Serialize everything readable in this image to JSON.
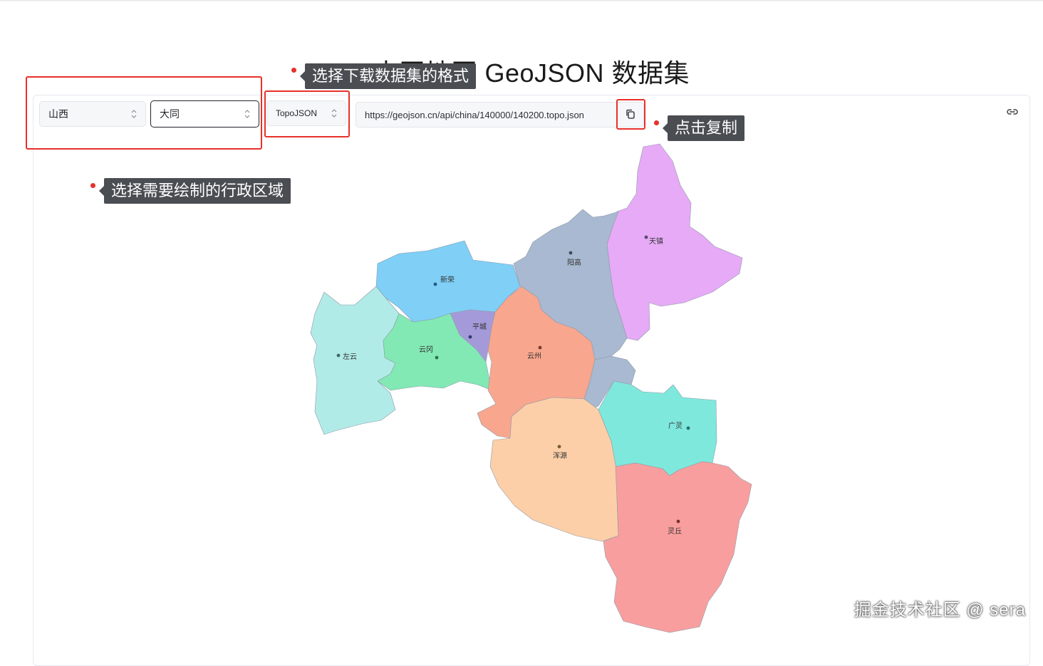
{
  "page": {
    "title": "中国地图 GeoJSON 数据集"
  },
  "controls": {
    "province": "山西",
    "city": "大同",
    "format": "TopoJSON",
    "url": "https://geojson.cn/api/china/140000/140200.topo.json"
  },
  "annotations": {
    "format_tip": "选择下载数据集的格式",
    "copy_tip": "点击复制",
    "region_tip": "选择需要绘制的行政区域"
  },
  "icons": {
    "copy": "copy-icon",
    "link": "link-icon",
    "chevron": "chevron-updown-icon"
  },
  "map": {
    "regions": [
      {
        "name": "天镇",
        "color": "#e6aaf6"
      },
      {
        "name": "阳高",
        "color": "#a8b9d1"
      },
      {
        "name": "新荣",
        "color": "#7fcff7"
      },
      {
        "name": "左云",
        "color": "#b1ebe7"
      },
      {
        "name": "云冈",
        "color": "#82e9b4"
      },
      {
        "name": "平城",
        "color": "#a59ad9"
      },
      {
        "name": "云州",
        "color": "#f8a68e"
      },
      {
        "name": "广灵",
        "color": "#7fe8dc"
      },
      {
        "name": "浑源",
        "color": "#fccfa8"
      },
      {
        "name": "灵丘",
        "color": "#f99e9e"
      }
    ]
  },
  "watermark": "掘金技术社区 @ sera",
  "colors": {
    "highlight": "#e8302a",
    "tooltip_bg": "#4a4d52"
  }
}
